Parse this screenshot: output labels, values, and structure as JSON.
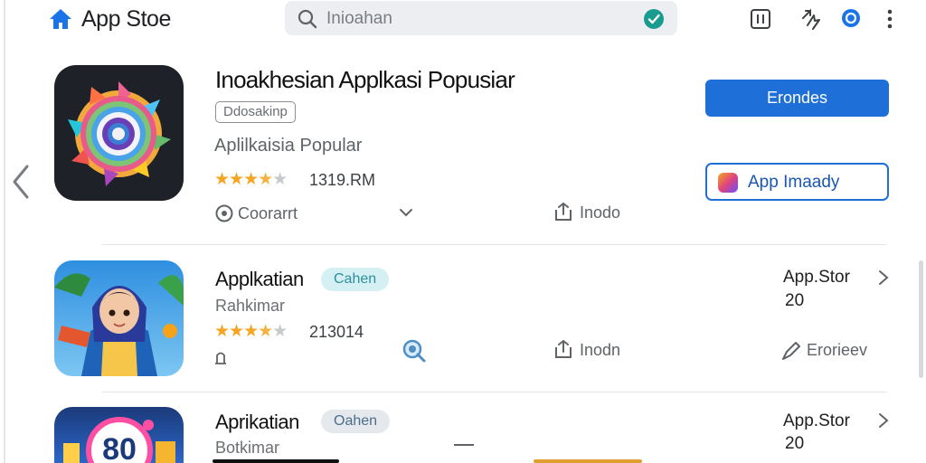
{
  "header": {
    "brand": "App Stoe",
    "search_value": "Inioahan",
    "actions": [
      "tablet-icon",
      "share-icon",
      "refresh-circle-icon",
      "more-vert-icon"
    ]
  },
  "featured": {
    "title": "Inoakhesian Applkasi Popusiar",
    "badge": "Ddosakinp",
    "subtitle": "Aplilkaisia Popular",
    "rating": 3.5,
    "rating_text": "1319.RM",
    "comment_label": "Coorarrt",
    "share_label": "Inodo",
    "primary_button": "Erondes",
    "secondary_button": "App Imaady"
  },
  "rows": [
    {
      "title": "Applkatian",
      "tag": "Cahen",
      "subtitle": "Rahkimar",
      "rating": 3.5,
      "rating_text": "213014",
      "store_label": "App.Stor",
      "store_number": "20",
      "share_label": "Inodn",
      "review_label": "Erorieev"
    },
    {
      "title": "Aprikatian",
      "tag": "Oahen",
      "subtitle": "Botkimar",
      "store_label": "App.Stor",
      "store_number": "20",
      "icon_text": "80"
    }
  ],
  "colors": {
    "accent": "#1f6fd8",
    "star": "#f4a522",
    "tag_teal": "#d4f0f3",
    "tag_gray": "#e5e8ed"
  }
}
